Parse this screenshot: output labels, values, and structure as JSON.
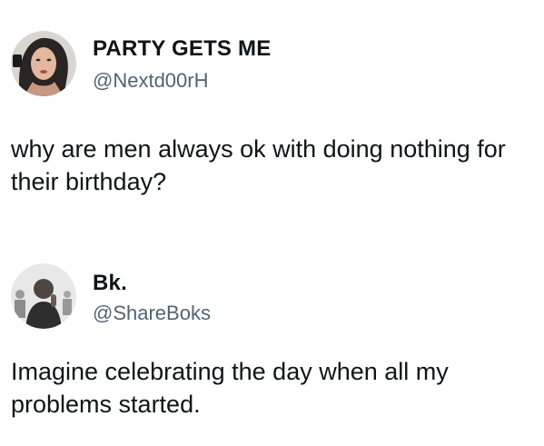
{
  "tweets": [
    {
      "display_name": "PARTY GETS ME",
      "handle": "@Nextd00rH",
      "text": "why are men always ok with doing nothing for\ntheir birthday?"
    },
    {
      "display_name": "Bk.",
      "handle": "@ShareBoks",
      "text": "Imagine celebrating the day when all my\nproblems started."
    }
  ]
}
